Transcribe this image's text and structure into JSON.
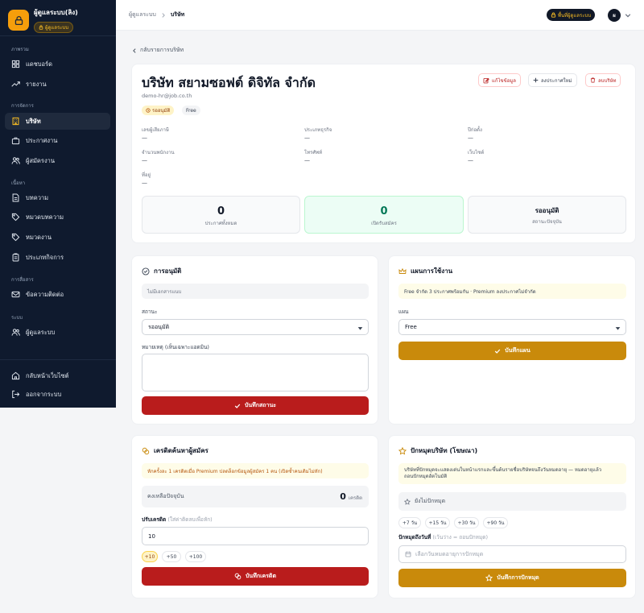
{
  "app": {
    "name": "ผู้ดูแลระบบ(ลิง)",
    "role_badge": "ผู้ดูแลระบบ"
  },
  "sidebar": {
    "sections": [
      {
        "title": "ภาพรวม",
        "items": [
          {
            "label": "แดชบอร์ด",
            "icon": "dashboard-icon"
          },
          {
            "label": "รายงาน",
            "icon": "trend-icon"
          }
        ]
      },
      {
        "title": "การจัดการ",
        "items": [
          {
            "label": "บริษัท",
            "icon": "building-icon",
            "active": true
          },
          {
            "label": "ประกาศงาน",
            "icon": "briefcase-icon"
          },
          {
            "label": "ผู้สมัครงาน",
            "icon": "users-icon"
          }
        ]
      },
      {
        "title": "เนื้อหา",
        "items": [
          {
            "label": "บทความ",
            "icon": "document-icon"
          },
          {
            "label": "หมวดบทความ",
            "icon": "tag-icon"
          },
          {
            "label": "หมวดงาน",
            "icon": "tag-icon"
          },
          {
            "label": "ประเภทกิจการ",
            "icon": "clipboard-icon"
          }
        ]
      },
      {
        "title": "การสื่อสาร",
        "items": [
          {
            "label": "ข้อความติดต่อ",
            "icon": "mail-icon"
          }
        ]
      },
      {
        "title": "ระบบ",
        "items": [
          {
            "label": "ผู้ดูแลระบบ",
            "icon": "users-icon"
          }
        ]
      }
    ],
    "footer": [
      {
        "label": "กลับหน้าเว็บไซต์",
        "icon": "home-icon"
      },
      {
        "label": "ออกจากระบบ",
        "icon": "logout-icon"
      }
    ]
  },
  "topbar": {
    "breadcrumb_parent": "ผู้ดูแลระบบ",
    "breadcrumb_current": "บริษัท",
    "admin_pill": "พื้นที่ผู้ดูแลระบบ",
    "avatar_initial": "ผ"
  },
  "back_link": "กลับรายการบริษัท",
  "company": {
    "name": "บริษัท สยามซอฟต์ ดิจิทัล จำกัด",
    "email": "demo-hr@job.co.th",
    "status_tag": "รออนุมัติ",
    "plan_tag": "Free",
    "actions": {
      "edit": "แก้ไขข้อมูล",
      "new_job": "ลงประกาศใหม่",
      "delete": "ลบบริษัท"
    },
    "info": [
      {
        "label": "เลขผู้เสียภาษี",
        "value": "—"
      },
      {
        "label": "ประเภทธุรกิจ",
        "value": "—"
      },
      {
        "label": "ปีก่อตั้ง",
        "value": "—"
      },
      {
        "label": "จำนวนพนักงาน",
        "value": "—"
      },
      {
        "label": "โทรศัพท์",
        "value": "—"
      },
      {
        "label": "เว็บไซต์",
        "value": "—"
      },
      {
        "label": "ที่อยู่",
        "value": "—"
      }
    ],
    "stats": [
      {
        "value": "0",
        "label": "ประกาศทั้งหมด"
      },
      {
        "value": "0",
        "label": "เปิดรับสมัคร"
      },
      {
        "value": "รออนุมัติ",
        "label": "สถานะปัจจุบัน"
      }
    ]
  },
  "approval": {
    "title": "การอนุมัติ",
    "doc_notice": "ไม่มีเอกสารแนบ",
    "status_label": "สถานะ",
    "status_value": "รออนุมัติ",
    "note_label": "หมายเหตุ (เห็นเฉพาะแอดมิน)",
    "save_button": "บันทึกสถานะ"
  },
  "plan": {
    "title": "แผนการใช้งาน",
    "notice": "Free จำกัด 3 ประกาศพร้อมกัน · Premium ลงประกาศไม่จำกัด",
    "plan_label": "แผน",
    "plan_value": "Free",
    "save_button": "บันทึกแผน"
  },
  "credits": {
    "title": "เครดิตค้นหาผู้สมัคร",
    "notice": "หักครั้งละ 1 เครดิตเมื่อ Premium ปลดล็อกข้อมูลผู้สมัคร 1 คน (เปิดซ้ำคนเดิมไม่หัก)",
    "balance_label": "คงเหลือปัจจุบัน",
    "balance_value": "0",
    "balance_unit": "เครดิต",
    "adjust_label": "ปรับเครดิต",
    "adjust_hint": "(ใส่ค่าติดลบเพื่อหัก)",
    "adjust_value": "10",
    "chips": [
      "+10",
      "+50",
      "+100"
    ],
    "save_button": "บันทึกเครดิต"
  },
  "pin": {
    "title": "ปักหมุดบริษัท (โฆษณา)",
    "notice_line1": "บริษัทที่ปักหมุดจะแสดงเด่นในหน้าแรกและขึ้นต้นรายชื่อบริษัทจนถึงวันหมดอายุ — หมดอายุแล้ว",
    "notice_line2": "ถอนปักหมุดอัตโนมัติ",
    "current_state": "ยังไม่ปักหมุด",
    "chips": [
      "+7 วัน",
      "+15 วัน",
      "+30 วัน",
      "+90 วัน"
    ],
    "date_label": "ปักหมุดถึงวันที่",
    "date_hint": "(เว้นว่าง = ถอนปักหมุด)",
    "date_placeholder": "เลือกวันหมดอายุการปักหมุด",
    "save_button": "บันทึกการปักหมุด"
  },
  "colors": {
    "sidebar_bg": "#0f1a2e",
    "accent_gold": "#c98a0b",
    "danger_red": "#b91c1c",
    "active_icon": "#fbbf24"
  }
}
